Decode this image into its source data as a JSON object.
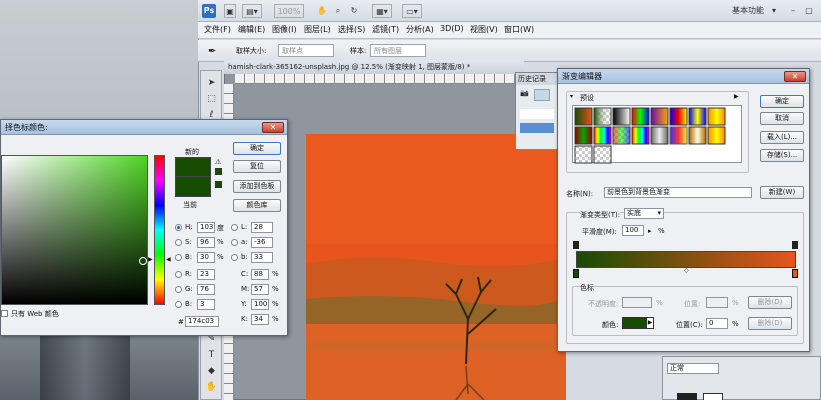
{
  "colors": {
    "canvas_orange": "#e8541e",
    "new_color": "#174c03",
    "current_color": "#174c03",
    "gradient_end": "#e8541e"
  },
  "app": {
    "ps_logo": "Ps",
    "zoom": "100%",
    "workspace": "基本功能"
  },
  "menu": [
    "文件(F)",
    "编辑(E)",
    "图像(I)",
    "图层(L)",
    "选择(S)",
    "滤镜(T)",
    "分析(A)",
    "3D(D)",
    "视图(V)",
    "窗口(W)"
  ],
  "options": {
    "sample_size_label": "取样大小:",
    "sample_size_value": "取样点",
    "sample_label": "样本:",
    "sample_value": "所有图层"
  },
  "document": {
    "title": "hamish-clark-365162-unsplash.jpg @ 12.5% (渐变映射 1, 图层蒙版/8) *"
  },
  "history": {
    "tab": "历史记录",
    "item": "ha"
  },
  "color_picker": {
    "title": "拾色器(前景色)",
    "title_visible": "择色标颜色:",
    "ok": "确定",
    "reset": "复位",
    "add_swatch": "添加到色板",
    "library": "颜色库",
    "new_label": "新的",
    "current_label": "当前",
    "web_only": "只有 Web 颜色",
    "H": {
      "label": "H:",
      "value": "103",
      "unit": "度"
    },
    "S": {
      "label": "S:",
      "value": "96",
      "unit": "%"
    },
    "B": {
      "label": "B:",
      "value": "30",
      "unit": "%"
    },
    "R": {
      "label": "R:",
      "value": "23"
    },
    "G": {
      "label": "G:",
      "value": "76"
    },
    "Bl": {
      "label": "B:",
      "value": "3"
    },
    "L": {
      "label": "L:",
      "value": "28"
    },
    "a": {
      "label": "a:",
      "value": "-36"
    },
    "b": {
      "label": "b:",
      "value": "33"
    },
    "C": {
      "label": "C:",
      "value": "88",
      "unit": "%"
    },
    "M": {
      "label": "M:",
      "value": "57",
      "unit": "%"
    },
    "Y": {
      "label": "Y:",
      "value": "100",
      "unit": "%"
    },
    "K": {
      "label": "K:",
      "value": "34",
      "unit": "%"
    },
    "hex_label": "#",
    "hex": "174c03"
  },
  "gradient_editor": {
    "title": "渐变编辑器",
    "presets_label": "预设",
    "ok": "确定",
    "cancel": "取消",
    "load": "载入(L)...",
    "save": "存储(S)...",
    "name_label": "名称(N):",
    "name_value": "前景色到背景色渐变",
    "new_btn": "新建(W)",
    "type_label": "渐变类型(T):",
    "type_value": "实底",
    "smooth_label": "平滑度(M):",
    "smooth_value": "100",
    "smooth_unit": "%",
    "stops_group": "色标",
    "opacity_label": "不透明度:",
    "opacity_unit": "%",
    "position_label": "位置:",
    "delete": "删除(D)",
    "color_label": "颜色:",
    "position_c_label": "位置(C):",
    "position_c_value": "0",
    "position_c_unit": "%",
    "delete2": "删除(D)"
  },
  "layers": {
    "mode": "正常"
  }
}
